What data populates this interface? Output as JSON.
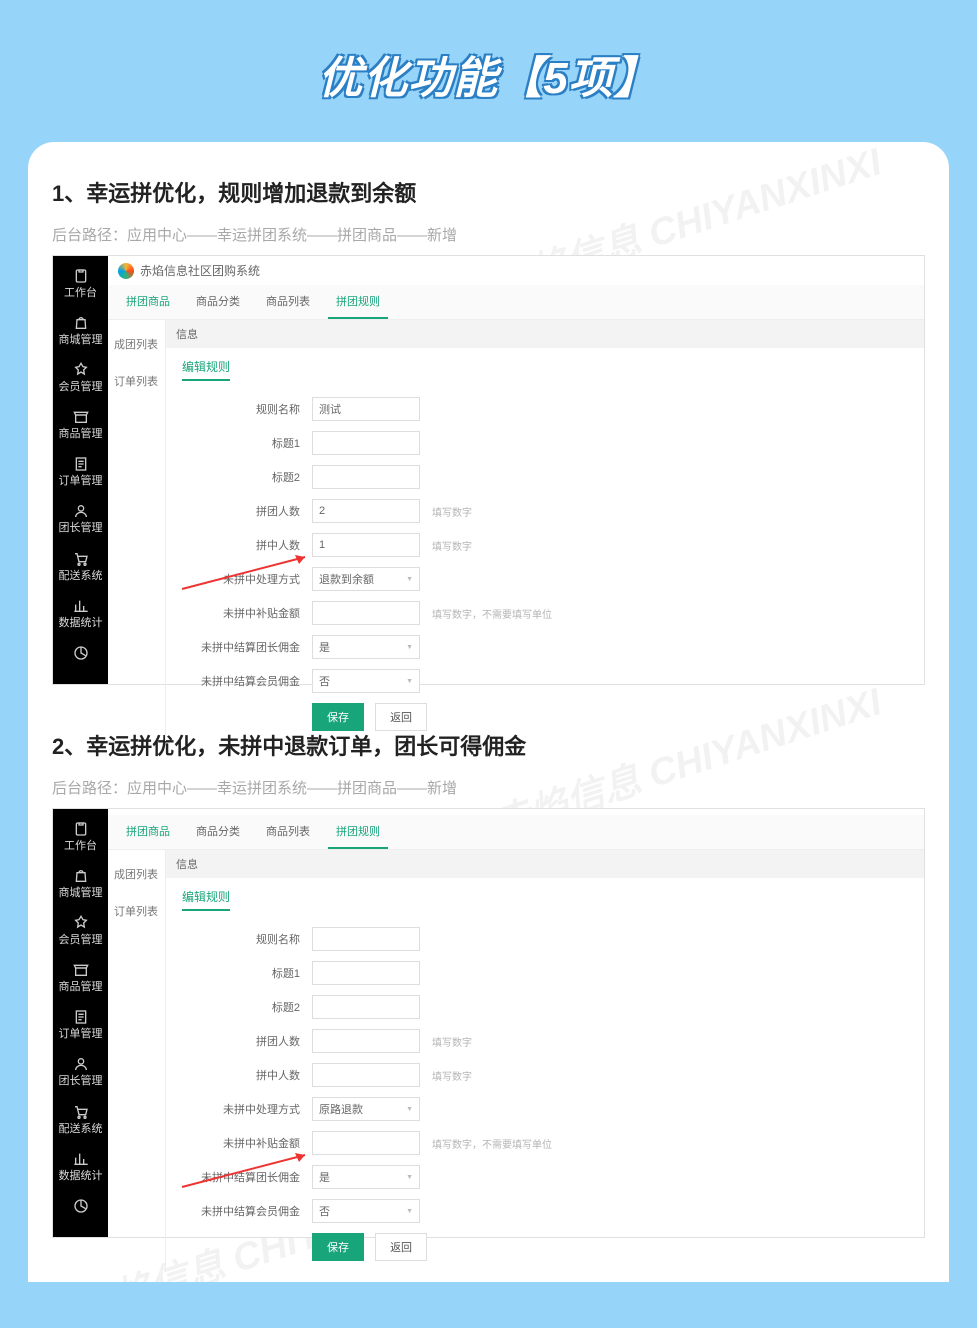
{
  "page_title": "优化功能【5项】",
  "sidebar": {
    "items": [
      {
        "label": "工作台",
        "icon": "clipboard"
      },
      {
        "label": "商城管理",
        "icon": "bag"
      },
      {
        "label": "会员管理",
        "icon": "badge"
      },
      {
        "label": "商品管理",
        "icon": "shop"
      },
      {
        "label": "订单管理",
        "icon": "doc"
      },
      {
        "label": "团长管理",
        "icon": "user"
      },
      {
        "label": "配送系统",
        "icon": "cart"
      },
      {
        "label": "数据统计",
        "icon": "bar"
      },
      {
        "label": "",
        "icon": "pie"
      }
    ]
  },
  "section1": {
    "title": "1、幸运拼优化，规则增加退款到余额",
    "path": "后台路径：应用中心——幸运拼团系统——拼团商品——新增",
    "brand": "赤焰信息社区团购系统",
    "tabs": [
      "拼团商品",
      "商品分类",
      "商品列表",
      "拼团规则"
    ],
    "active_tab_index": 3,
    "subnav": [
      "成团列表",
      "订单列表"
    ],
    "header": "信息",
    "crumb": "编辑规则",
    "fields": {
      "rule_name": {
        "label": "规则名称",
        "value": "测试"
      },
      "title1": {
        "label": "标题1",
        "value": ""
      },
      "title2": {
        "label": "标题2",
        "value": ""
      },
      "group_count": {
        "label": "拼团人数",
        "value": "2",
        "hint": "填写数字"
      },
      "win_count": {
        "label": "拼中人数",
        "value": "1",
        "hint": "填写数字"
      },
      "unwin_method": {
        "label": "未拼中处理方式",
        "value": "退款到余额"
      },
      "unwin_amount": {
        "label": "未拼中补贴金额",
        "value": "",
        "hint": "填写数字，不需要填写单位"
      },
      "leader_comm": {
        "label": "未拼中结算团长佣金",
        "value": "是"
      },
      "member_comm": {
        "label": "未拼中结算会员佣金",
        "value": "否"
      }
    },
    "buttons": {
      "save": "保存",
      "back": "返回"
    }
  },
  "section2": {
    "title": "2、幸运拼优化，未拼中退款订单，团长可得佣金",
    "path": "后台路径：应用中心——幸运拼团系统——拼团商品——新增",
    "tabs": [
      "拼团商品",
      "商品分类",
      "商品列表",
      "拼团规则"
    ],
    "active_tab_index": 3,
    "subnav": [
      "成团列表",
      "订单列表"
    ],
    "header": "信息",
    "crumb": "编辑规则",
    "fields": {
      "rule_name": {
        "label": "规则名称",
        "value": ""
      },
      "title1": {
        "label": "标题1",
        "value": ""
      },
      "title2": {
        "label": "标题2",
        "value": ""
      },
      "group_count": {
        "label": "拼团人数",
        "value": "",
        "hint": "填写数字"
      },
      "win_count": {
        "label": "拼中人数",
        "value": "",
        "hint": "填写数字"
      },
      "unwin_method": {
        "label": "未拼中处理方式",
        "value": "原路退款"
      },
      "unwin_amount": {
        "label": "未拼中补贴金额",
        "value": "",
        "hint": "填写数字，不需要填写单位"
      },
      "leader_comm": {
        "label": "未拼中结算团长佣金",
        "value": "是"
      },
      "member_comm": {
        "label": "未拼中结算会员佣金",
        "value": "否"
      }
    },
    "buttons": {
      "save": "保存",
      "back": "返回"
    }
  },
  "watermark": "赤焰信息 CHIYANXINXI"
}
